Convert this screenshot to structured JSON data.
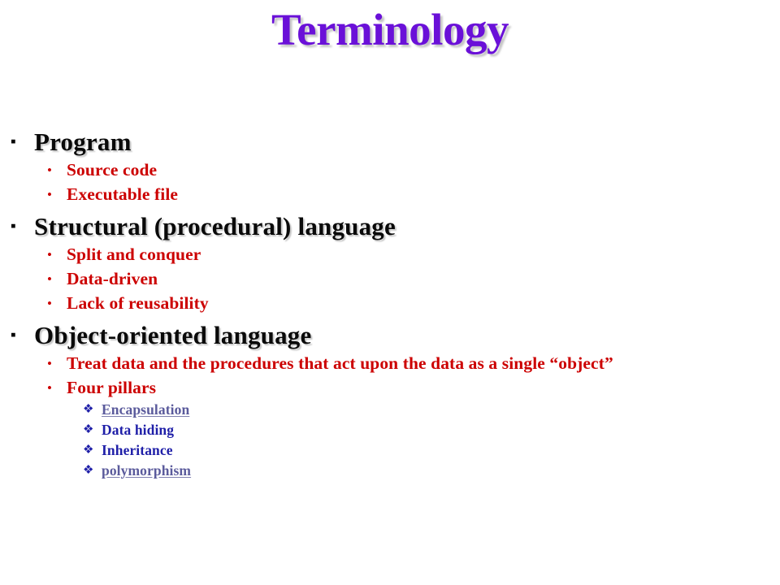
{
  "slide": {
    "title": "Terminology",
    "title_color": "#6A10D8",
    "background_color": "#ffffff",
    "level1_color": "#0a0a0a",
    "level2_color": "#CC0000",
    "level3_color": "#1F1FA8",
    "link_color": "#5B5B9C",
    "markers": {
      "level1": "▪",
      "level2": "•",
      "level3": "❖"
    },
    "bullets": [
      {
        "level": 1,
        "marker_name": "square-bullet-icon",
        "text": "Program",
        "is_link": false
      },
      {
        "level": 2,
        "marker_name": "round-bullet-icon",
        "text": "Source code",
        "is_link": false
      },
      {
        "level": 2,
        "marker_name": "round-bullet-icon",
        "text": "Executable file",
        "is_link": false
      },
      {
        "level": 1,
        "marker_name": "square-bullet-icon",
        "text": "Structural (procedural)  language",
        "is_link": false
      },
      {
        "level": 2,
        "marker_name": "round-bullet-icon",
        "text": "Split and conquer",
        "is_link": false
      },
      {
        "level": 2,
        "marker_name": "round-bullet-icon",
        "text": "Data-driven",
        "is_link": false
      },
      {
        "level": 2,
        "marker_name": "round-bullet-icon",
        "text": "Lack of reusability",
        "is_link": false
      },
      {
        "level": 1,
        "marker_name": "square-bullet-icon",
        "text": "Object-oriented  language",
        "is_link": false
      },
      {
        "level": 2,
        "marker_name": "round-bullet-icon",
        "text": "Treat data and the procedures that act upon the data as a single “object”",
        "is_link": false
      },
      {
        "level": 2,
        "marker_name": "round-bullet-icon",
        "text": "Four pillars",
        "is_link": false
      },
      {
        "level": 3,
        "marker_name": "diamond-bullet-icon",
        "text": "Encapsulation",
        "is_link": true
      },
      {
        "level": 3,
        "marker_name": "diamond-bullet-icon",
        "text": "Data hiding",
        "is_link": false
      },
      {
        "level": 3,
        "marker_name": "diamond-bullet-icon",
        "text": "Inheritance",
        "is_link": false
      },
      {
        "level": 3,
        "marker_name": "diamond-bullet-icon",
        "text": "polymorphism",
        "is_link": true
      }
    ]
  }
}
